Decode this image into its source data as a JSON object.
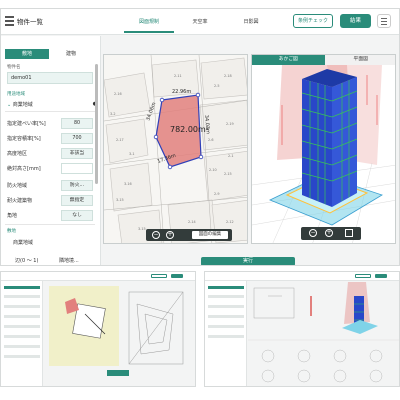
{
  "app": {
    "title": "物件一覧"
  },
  "nav": {
    "tabs": [
      "図面規制",
      "天空率",
      "日影図"
    ],
    "active": 0
  },
  "header": {
    "check_label": "条例チェック",
    "result_label": "結果"
  },
  "sidebar": {
    "tabs": [
      "敷地",
      "建物"
    ],
    "name_label": "物件名",
    "name_value": "demo01",
    "district_label": "用途地域",
    "district_value": "商業地域",
    "rows": [
      {
        "label": "指定建ぺい率[%]",
        "value": "80"
      },
      {
        "label": "指定容積率[%]",
        "value": "700"
      },
      {
        "label": "高度地区",
        "value": "非該当"
      },
      {
        "label": "絶対高さ[mm]",
        "value": ""
      },
      {
        "label": "防火地域",
        "value": "防火..."
      },
      {
        "label": "耐火建築物",
        "value": "無指定"
      },
      {
        "label": "角地",
        "value": "なし"
      }
    ],
    "lower_section": "敷地",
    "lower_district": "商業地域",
    "lower_row_label": "辺(0 〜 1)",
    "lower_row_value": "隣地境..."
  },
  "map": {
    "area_label": "782.00m²",
    "dim_top": "22.96m",
    "dim_left": "34.06m",
    "dim_bottom": "17.36m",
    "dim_right": "34.03m",
    "edit_label": "図面の編集",
    "lot_labels": [
      "2-16",
      "2-18",
      "2-19",
      "2-17",
      "3-16",
      "3-15",
      "2-15",
      "2-14",
      "2-12",
      "2-11",
      "2-9",
      "3-2",
      "3-1",
      "2-5",
      "2-6",
      "2-10",
      "2-1",
      "3-15"
    ]
  },
  "view": {
    "tabs": [
      "あかご図",
      "平面図"
    ],
    "active": 0
  },
  "actions": {
    "run_label": "実行"
  },
  "colors": {
    "accent": "#2a8c7a",
    "site": "#e2807d",
    "building": "#2947c9"
  }
}
